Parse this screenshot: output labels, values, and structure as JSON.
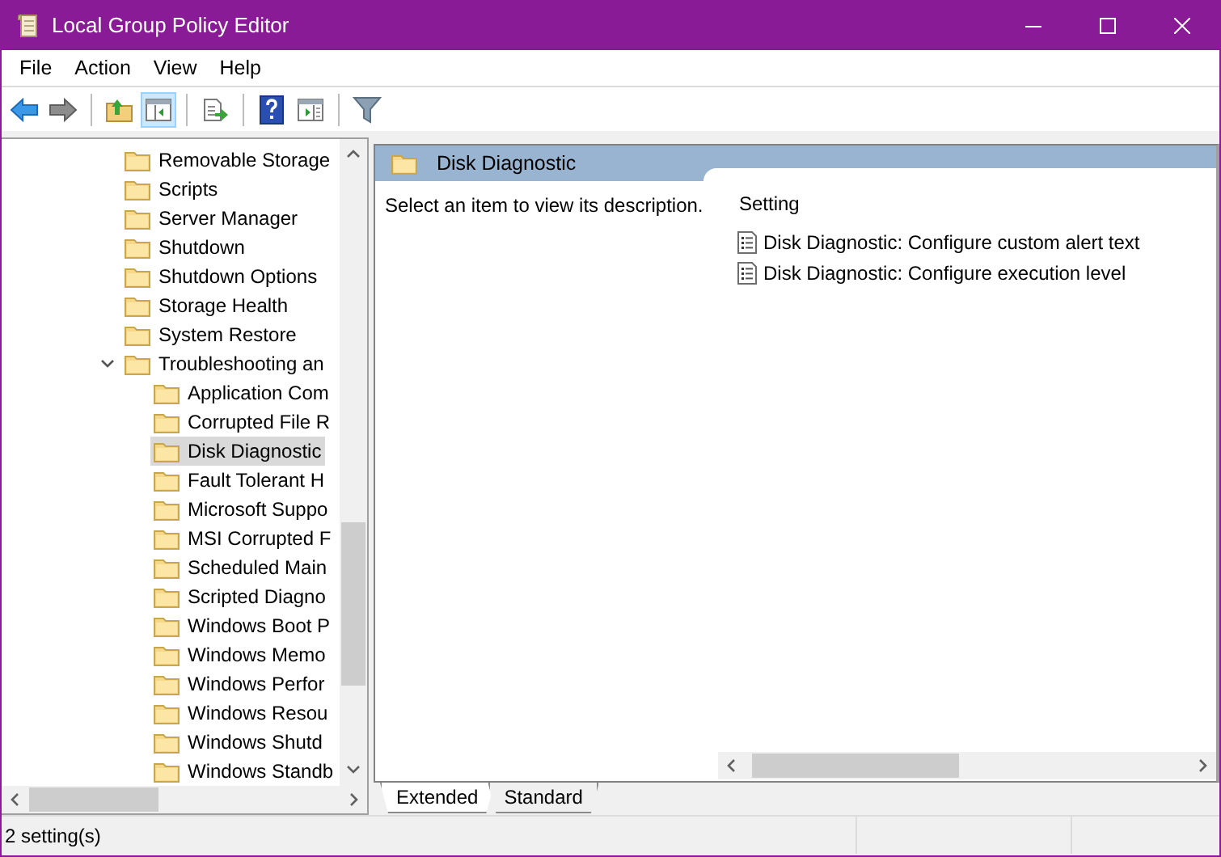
{
  "window": {
    "title": "Local Group Policy Editor"
  },
  "menu": [
    "File",
    "Action",
    "View",
    "Help"
  ],
  "toolbar": [
    {
      "kind": "back",
      "pressed": false
    },
    {
      "kind": "forward",
      "pressed": false
    },
    {
      "kind": "separator"
    },
    {
      "kind": "up",
      "pressed": false
    },
    {
      "kind": "tree",
      "pressed": true
    },
    {
      "kind": "separator"
    },
    {
      "kind": "export",
      "pressed": false
    },
    {
      "kind": "separator"
    },
    {
      "kind": "help",
      "pressed": false
    },
    {
      "kind": "action",
      "pressed": false
    },
    {
      "kind": "separator"
    },
    {
      "kind": "filter",
      "pressed": false
    }
  ],
  "tree": {
    "items": [
      {
        "label": "Removable Storage",
        "selected": false
      },
      {
        "label": "Scripts",
        "selected": false
      },
      {
        "label": "Server Manager",
        "selected": false
      },
      {
        "label": "Shutdown",
        "selected": false
      },
      {
        "label": "Shutdown Options",
        "selected": false
      },
      {
        "label": "Storage Health",
        "selected": false
      },
      {
        "label": "System Restore",
        "selected": false
      },
      {
        "label": "Troubleshooting an",
        "selected": false,
        "expanded": true,
        "children": [
          {
            "label": "Application Com",
            "selected": false
          },
          {
            "label": "Corrupted File R",
            "selected": false
          },
          {
            "label": "Disk Diagnostic",
            "selected": true
          },
          {
            "label": "Fault Tolerant H",
            "selected": false
          },
          {
            "label": "Microsoft Suppo",
            "selected": false
          },
          {
            "label": "MSI Corrupted F",
            "selected": false
          },
          {
            "label": "Scheduled Main",
            "selected": false
          },
          {
            "label": "Scripted Diagno",
            "selected": false
          },
          {
            "label": "Windows Boot P",
            "selected": false
          },
          {
            "label": "Windows Memo",
            "selected": false
          },
          {
            "label": "Windows Perfor",
            "selected": false
          },
          {
            "label": "Windows Resou",
            "selected": false
          },
          {
            "label": "Windows Shutd",
            "selected": false
          },
          {
            "label": "Windows Standb",
            "selected": false
          }
        ]
      }
    ]
  },
  "details": {
    "header": "Disk Diagnostic",
    "description": "Select an item to view its description.",
    "column": "Setting",
    "settings": [
      "Disk Diagnostic: Configure custom alert text",
      "Disk Diagnostic: Configure execution level"
    ]
  },
  "view_tabs": [
    {
      "label": "Extended",
      "selected": true
    },
    {
      "label": "Standard",
      "selected": false
    }
  ],
  "status_bar": "2 setting(s)"
}
